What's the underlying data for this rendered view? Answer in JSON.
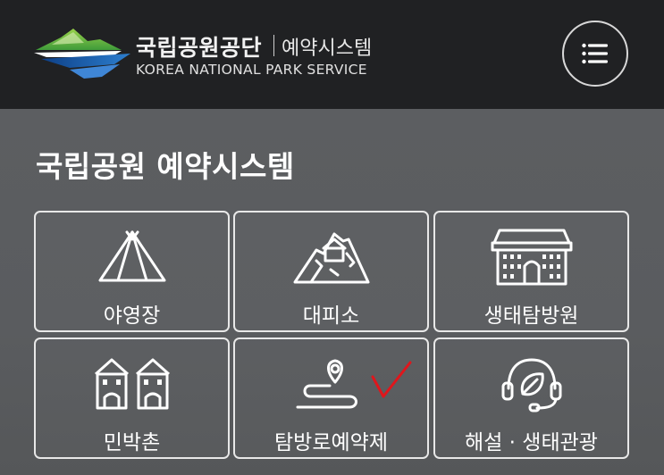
{
  "header": {
    "brand_name": "국립공원공단",
    "brand_sub": "예약시스템",
    "brand_en": "KOREA NATIONAL PARK SERVICE",
    "menu_icon": "hamburger-menu-icon"
  },
  "main": {
    "title": "국립공원 예약시스템",
    "tiles": [
      {
        "label": "야영장",
        "icon": "tent-icon"
      },
      {
        "label": "대피소",
        "icon": "mountain-shelter-icon"
      },
      {
        "label": "생태탐방원",
        "icon": "building-icon"
      },
      {
        "label": "민박촌",
        "icon": "houses-icon"
      },
      {
        "label": "탐방로예약제",
        "icon": "trail-route-icon"
      },
      {
        "label": "해설 · 생태관광",
        "icon": "headset-leaf-icon"
      }
    ]
  },
  "colors": {
    "header_bg": "#202123",
    "main_bg": "#5b5d60",
    "logo_green": "#7cc242",
    "logo_blue": "#1f5fa8",
    "check_mark": "#e0161c"
  }
}
